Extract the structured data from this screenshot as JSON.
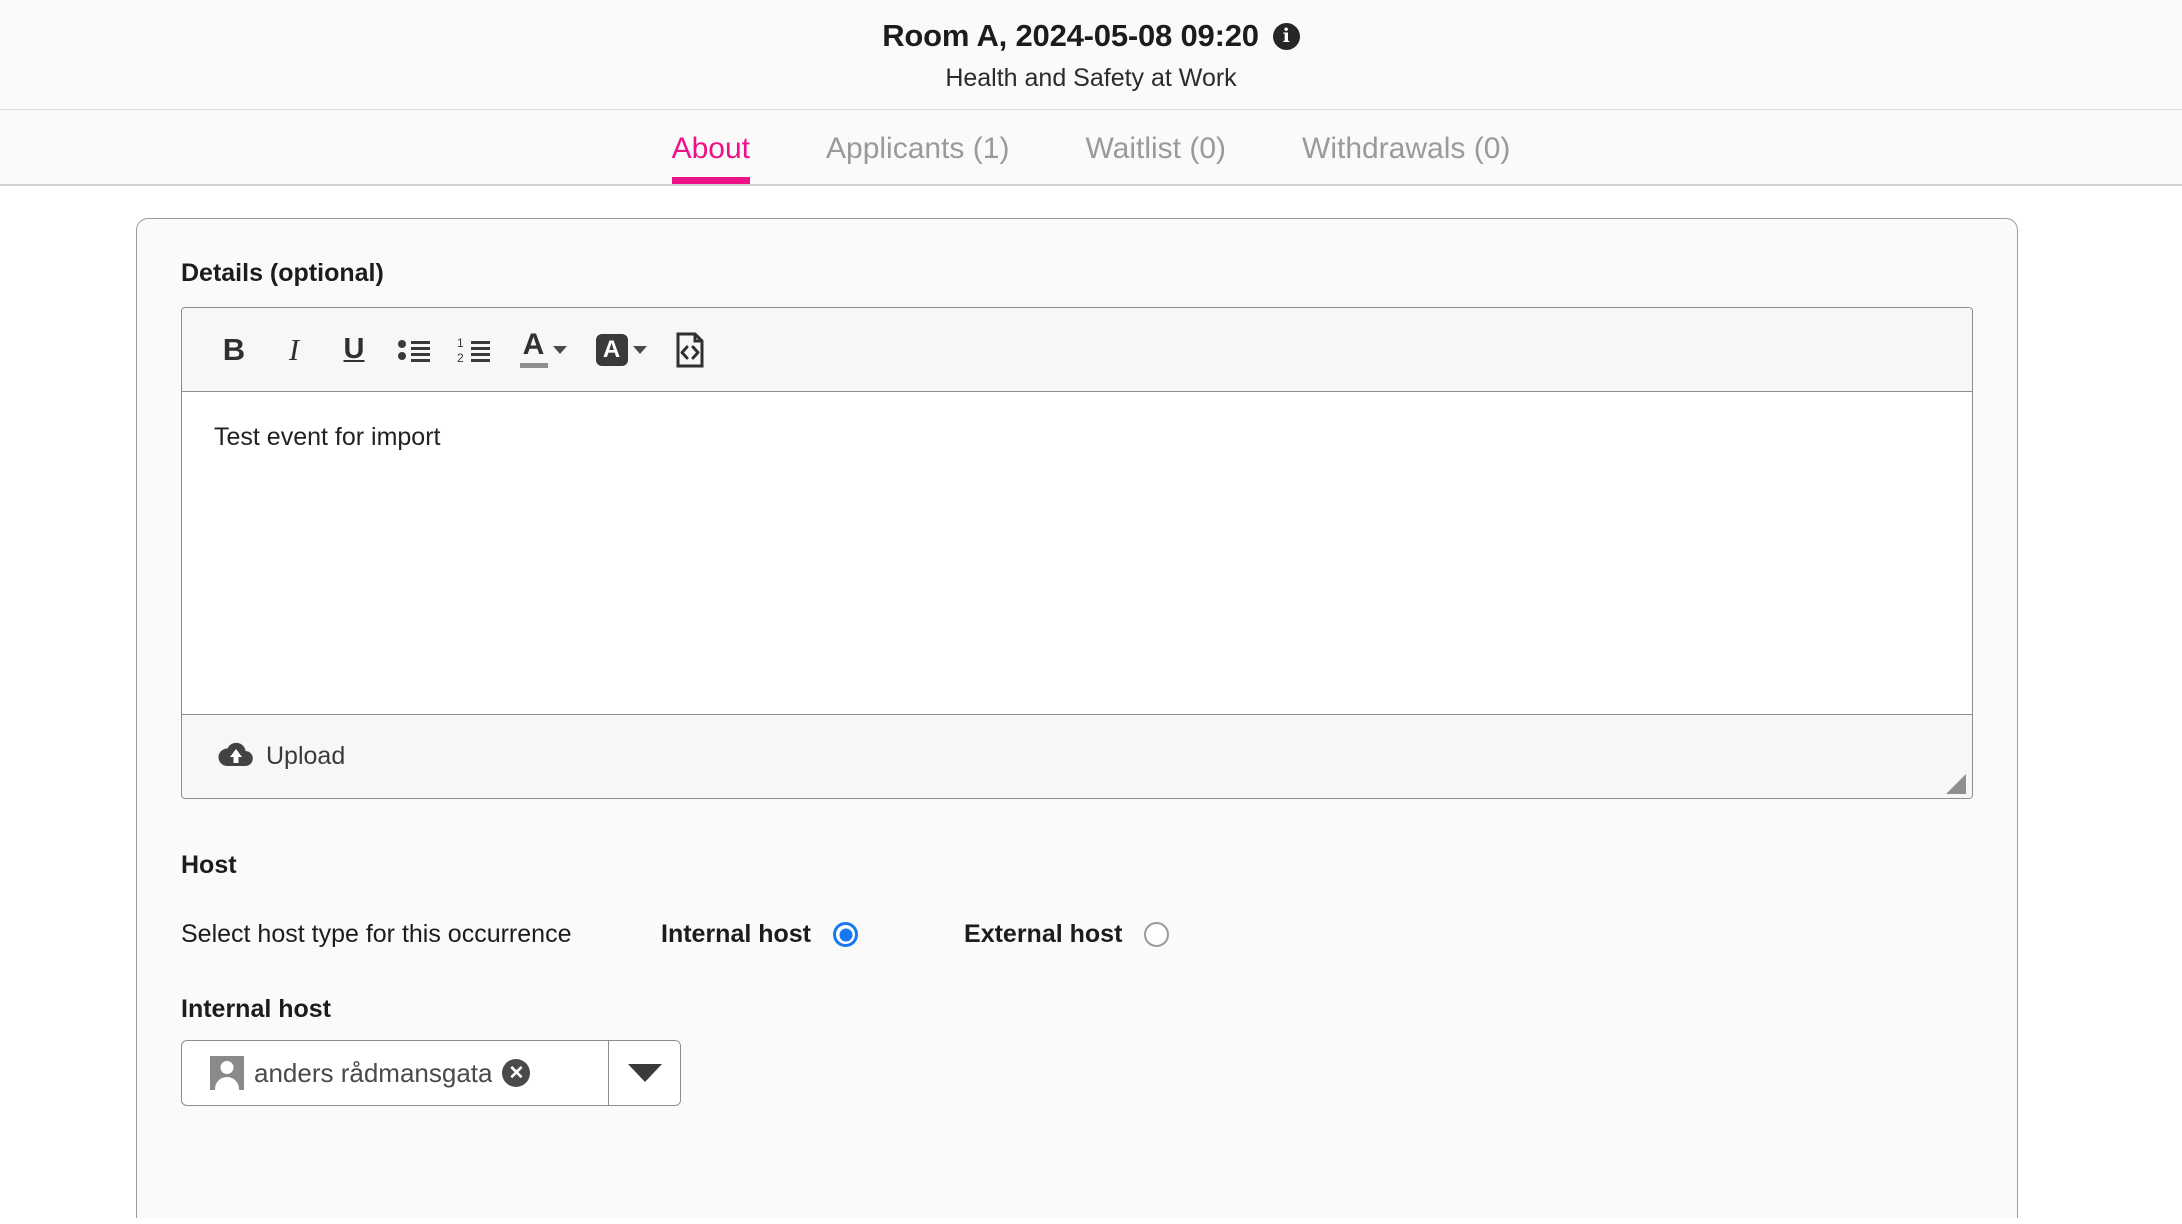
{
  "header": {
    "title": "Room A, 2024-05-08 09:20",
    "subtitle": "Health and Safety at Work",
    "info_icon": "info-icon",
    "info_glyph": "i"
  },
  "tabs": [
    {
      "label": "About",
      "active": true
    },
    {
      "label": "Applicants (1)",
      "active": false
    },
    {
      "label": "Waitlist (0)",
      "active": false
    },
    {
      "label": "Withdrawals (0)",
      "active": false
    }
  ],
  "details": {
    "label": "Details (optional)",
    "body_text": "Test event for import",
    "toolbar": [
      {
        "name": "bold-icon",
        "glyph": "B"
      },
      {
        "name": "italic-icon",
        "glyph": "I"
      },
      {
        "name": "underline-icon",
        "glyph": "U"
      },
      {
        "name": "bullet-list-icon",
        "glyph": "☰"
      },
      {
        "name": "numbered-list-icon",
        "glyph": "☰"
      },
      {
        "name": "text-color-icon",
        "glyph": "A"
      },
      {
        "name": "highlight-color-icon",
        "glyph": "A"
      },
      {
        "name": "source-code-icon",
        "glyph": "<>"
      }
    ],
    "upload_label": "Upload",
    "upload_icon": "cloud-upload-icon",
    "resize_handle": "resize-grip"
  },
  "host": {
    "section_title": "Host",
    "hint": "Select host type for this occurrence",
    "options": [
      {
        "label": "Internal host",
        "selected": true
      },
      {
        "label": "External host",
        "selected": false
      }
    ],
    "internal_host_label": "Internal host",
    "selected_host": "anders rådmansgata",
    "clear_glyph": "✕",
    "avatar_icon": "user-avatar-icon",
    "dropdown_icon": "chevron-down-icon"
  },
  "colors": {
    "accent_pink": "#ee1289",
    "radio_blue": "#1877f2",
    "text_dark": "#1c1c1c",
    "muted_gray": "#9a9a9a"
  }
}
